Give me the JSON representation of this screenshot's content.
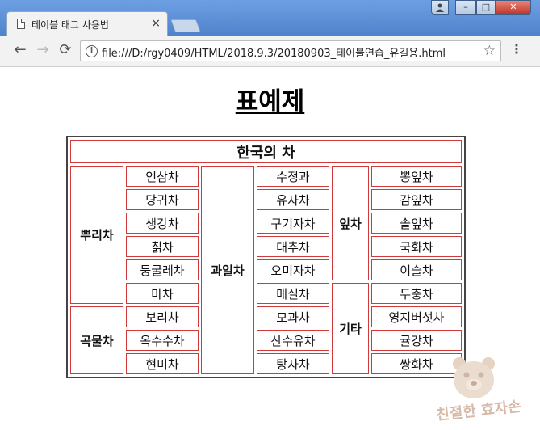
{
  "browser": {
    "tab_title": "테이블 태그 사용법",
    "tab_close": "×",
    "url": "file:///D:/rgy0409/HTML/2018.9.3/20180903_테이블연습_유길용.html",
    "window_buttons": {
      "min": "–",
      "max": "□",
      "close": "✕"
    },
    "nav": {
      "back": "←",
      "forward": "→",
      "reload": "⟳"
    },
    "star": "☆",
    "menu": "⋮"
  },
  "page": {
    "title": "표예제",
    "table": {
      "caption": "한국의 차",
      "groups": {
        "root": "뿌리차",
        "grain": "곡물차",
        "fruit": "과일차",
        "leaf": "잎차",
        "etc": "기타"
      },
      "root_items": [
        "인삼차",
        "당귀차",
        "생강차",
        "칡차",
        "둥굴레차",
        "마차"
      ],
      "grain_items": [
        "보리차",
        "옥수수차",
        "현미차"
      ],
      "fruit_items": [
        "수정과",
        "유자차",
        "구기자차",
        "대추차",
        "오미자차",
        "매실차",
        "모과차",
        "산수유차",
        "탕자차"
      ],
      "leaf_items": [
        "뽕잎차",
        "감잎차",
        "솔잎차",
        "국화차",
        "이슬차"
      ],
      "etc_items": [
        "두충차",
        "영지버섯차",
        "귤강차",
        "쌍화차"
      ]
    },
    "watermark": "친절한 효자손"
  }
}
